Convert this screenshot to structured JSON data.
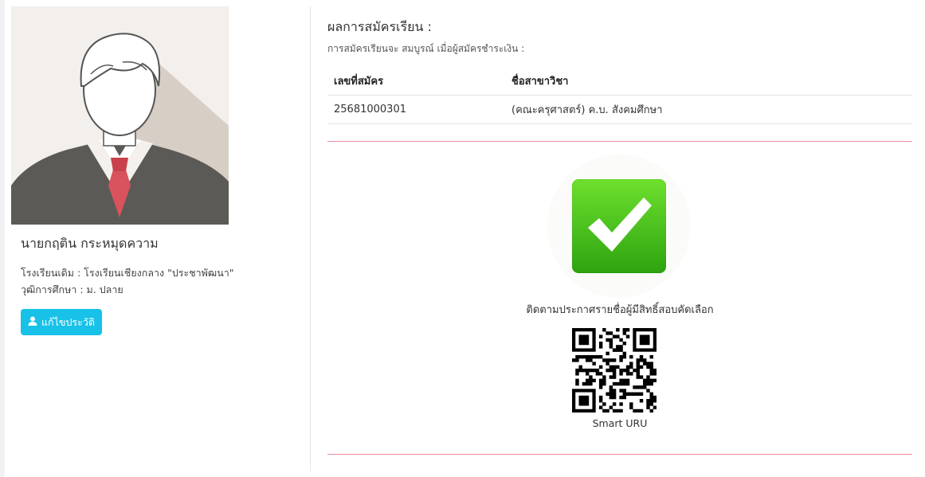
{
  "profile": {
    "name": "นายกฤติน กระหมุดความ",
    "school_line": "โรงเรียนเดิม : โรงเรียนเชียงกลาง \"ประชาพัฒนา\"",
    "education_line": "วุฒิการศึกษา : ม. ปลาย",
    "edit_button_label": "แก้ไขประวัติ",
    "avatar_icon": "user-avatar-icon"
  },
  "result": {
    "title": "ผลการสมัครเรียน :",
    "subtitle": "การสมัครเรียนจะ สมบูรณ์ เมื่อผู้สมัครชำระเงิน :",
    "columns": [
      "เลขที่สมัคร",
      "ชื่อสาขาวิชา"
    ],
    "rows": [
      {
        "app_no": "25681000301",
        "program": "(คณะครุศาสตร์) ค.บ. สังคมศึกษา"
      }
    ]
  },
  "status": {
    "icon": "check-mark-icon",
    "follow_text": "ติดตามประกาศรายชื่อผู้มีสิทธิ์สอบคัดเลือก",
    "qr_label": "Smart URU"
  },
  "colors": {
    "button": "#17c1e8",
    "divider_red": "#e7909e",
    "check_green": "#3bbf17"
  }
}
